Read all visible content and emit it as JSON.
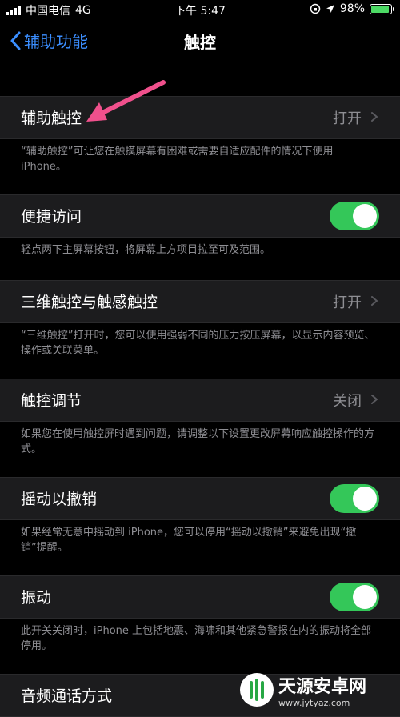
{
  "status_bar": {
    "carrier": "中国电信",
    "network": "4G",
    "time": "下午 5:47",
    "battery_percent": "98%",
    "battery_level": 0.98
  },
  "nav": {
    "back_label": "辅助功能",
    "title": "触控"
  },
  "rows": [
    {
      "label": "辅助触控",
      "value": "打开",
      "footer": "“辅助触控”可让您在触摸屏幕有困难或需要自适应配件的情况下使用 iPhone。"
    },
    {
      "label": "便捷访问",
      "toggle": true,
      "footer": "轻点两下主屏幕按钮，将屏幕上方项目拉至可及范围。"
    },
    {
      "label": "三维触控与触感触控",
      "value": "打开",
      "footer": "“三维触控”打开时，您可以使用强弱不同的压力按压屏幕，以显示内容预览、操作或关联菜单。"
    },
    {
      "label": "触控调节",
      "value": "关闭",
      "footer": "如果您在使用触控屏时遇到问题，请调整以下设置更改屏幕响应触控操作的方式。"
    },
    {
      "label": "摇动以撤销",
      "toggle": true,
      "footer": "如果经常无意中摇动到 iPhone，您可以停用“摇动以撤销”来避免出现“撤销”提醒。"
    },
    {
      "label": "振动",
      "toggle": true,
      "footer": "此开关关闭时，iPhone 上包括地震、海啸和其他紧急警报在内的振动将全部停用。"
    },
    {
      "label": "音频通话方式"
    }
  ],
  "watermark": {
    "title": "天源安卓网",
    "url": "www.jytyaz.com"
  },
  "colors": {
    "accent": "#3b8eff",
    "toggle_on": "#34c759",
    "annotation_arrow": "#f0508c"
  }
}
